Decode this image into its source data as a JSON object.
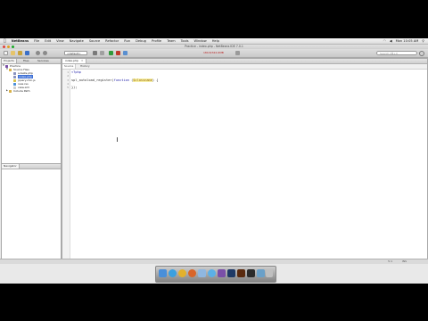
{
  "menubar": {
    "apple": "",
    "app_name": "NetBeans",
    "items": [
      "File",
      "Edit",
      "View",
      "Navigate",
      "Source",
      "Refactor",
      "Run",
      "Debug",
      "Profile",
      "Team",
      "Tools",
      "Window",
      "Help"
    ],
    "clock": "Mon 10:05 AM"
  },
  "window": {
    "title": "Practice - index.php - NetBeans IDE 7.0.1"
  },
  "toolbar": {
    "config_select": "<default>",
    "status_text": "180.8/322.6MB",
    "search_placeholder": "Search (⌘+I)",
    "colors": {
      "open": "#c8a23a",
      "save": "#3a6fc8",
      "run": "#2f9a3a",
      "debug": "#c0392b",
      "build": "#7a7a7a"
    }
  },
  "projects_panel": {
    "tabs": [
      "Projects",
      "Files",
      "Services"
    ],
    "tree": [
      {
        "label": "Practice",
        "level": 0,
        "icon": "project-icon",
        "expanded": true
      },
      {
        "label": "Source Files",
        "level": 1,
        "icon": "folder-icon",
        "expanded": true
      },
      {
        "label": "a-tests.php",
        "level": 2,
        "icon": "php-file-icon"
      },
      {
        "label": "index.php",
        "level": 2,
        "icon": "php-file-icon",
        "selected": true
      },
      {
        "label": "jquery-min.js",
        "level": 2,
        "icon": "js-file-icon"
      },
      {
        "label": "new.css",
        "level": 2,
        "icon": "css-file-icon"
      },
      {
        "label": "view.xml",
        "level": 2,
        "icon": "file-icon"
      },
      {
        "label": "Include Path",
        "level": 1,
        "icon": "folder-icon",
        "expanded": false
      }
    ]
  },
  "navigator_panel": {
    "tab": "Navigator"
  },
  "editor": {
    "tab_label": "index.php",
    "subbar": [
      "Source",
      "History"
    ],
    "lines": [
      {
        "n": "1",
        "parts": [
          {
            "t": "<?php",
            "c": "kw"
          }
        ]
      },
      {
        "n": "2",
        "parts": []
      },
      {
        "n": "3",
        "parts": [
          {
            "t": "spl_autoload_register",
            "c": "fn"
          },
          {
            "t": "(",
            "c": ""
          },
          {
            "t": "function",
            "c": "kw"
          },
          {
            "t": " (",
            "c": ""
          },
          {
            "t": "$classname",
            "c": "param"
          },
          {
            "t": ") {",
            "c": ""
          }
        ]
      },
      {
        "n": "4",
        "parts": [
          {
            "t": "    ",
            "c": ""
          }
        ]
      },
      {
        "n": "5",
        "parts": [
          {
            "t": "});",
            "c": ""
          }
        ]
      }
    ]
  },
  "statusbar": {
    "left": "",
    "position": "5:1",
    "mode": "INS"
  },
  "dock": {
    "icons": [
      {
        "name": "finder-icon",
        "color": "#4a8fd9"
      },
      {
        "name": "safari-icon",
        "color": "#3aa0e0"
      },
      {
        "name": "chrome-icon",
        "color": "#e3b12c"
      },
      {
        "name": "firefox-icon",
        "color": "#d8652a"
      },
      {
        "name": "mail-icon",
        "color": "#8fb7e0"
      },
      {
        "name": "itunes-icon",
        "color": "#5bb0e6"
      },
      {
        "name": "netbeans-icon",
        "color": "#7a4fa8"
      },
      {
        "name": "photoshop-icon",
        "color": "#1f3a66"
      },
      {
        "name": "illustrator-icon",
        "color": "#5a2a0e"
      },
      {
        "name": "terminal-icon",
        "color": "#2b2b2b"
      },
      {
        "name": "preview-icon",
        "color": "#6aa0c8"
      },
      {
        "name": "trash-icon",
        "color": "#bfbfbf"
      }
    ]
  }
}
